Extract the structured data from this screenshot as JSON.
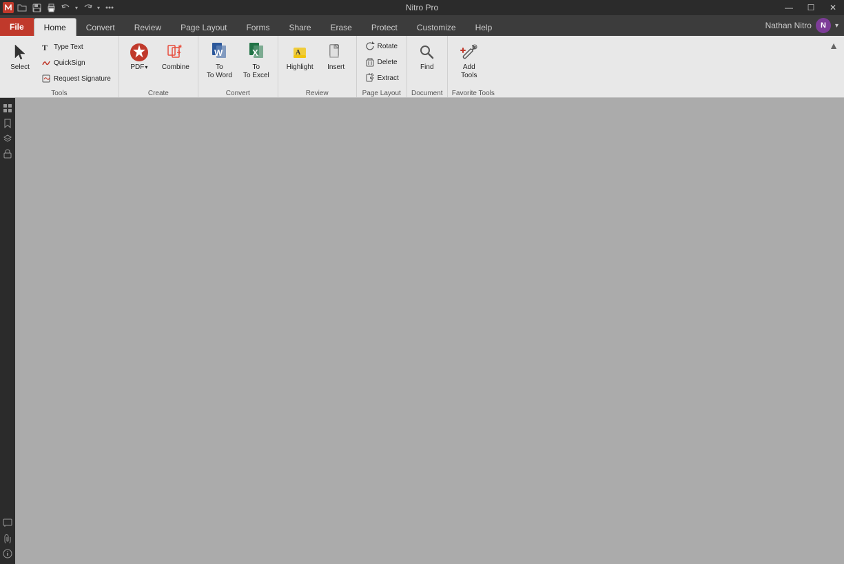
{
  "app": {
    "title": "Nitro Pro",
    "logo_letter": "N"
  },
  "window_controls": {
    "minimize": "—",
    "maximize": "☐",
    "close": "✕"
  },
  "quick_access": {
    "icons": [
      "save",
      "open",
      "print",
      "undo",
      "redo",
      "custom"
    ]
  },
  "tabs": [
    {
      "id": "file",
      "label": "File",
      "active": false
    },
    {
      "id": "home",
      "label": "Home",
      "active": true
    },
    {
      "id": "convert",
      "label": "Convert",
      "active": false
    },
    {
      "id": "review",
      "label": "Review",
      "active": false
    },
    {
      "id": "page-layout",
      "label": "Page Layout",
      "active": false
    },
    {
      "id": "forms",
      "label": "Forms",
      "active": false
    },
    {
      "id": "share",
      "label": "Share",
      "active": false
    },
    {
      "id": "erase",
      "label": "Erase",
      "active": false
    },
    {
      "id": "protect",
      "label": "Protect",
      "active": false
    },
    {
      "id": "customize",
      "label": "Customize",
      "active": false
    },
    {
      "id": "help",
      "label": "Help",
      "active": false
    }
  ],
  "user": {
    "name": "Nathan Nitro",
    "initials": "N"
  },
  "ribbon": {
    "groups": [
      {
        "id": "tools",
        "label": "Tools",
        "items": [
          {
            "id": "select",
            "label": "Select",
            "type": "large",
            "icon": "cursor"
          },
          {
            "id": "type-text",
            "label": "Type Text",
            "type": "small",
            "icon": "T"
          },
          {
            "id": "quicksign",
            "label": "QuickSign",
            "type": "small",
            "icon": "pen"
          },
          {
            "id": "request-signature",
            "label": "Request Signature",
            "type": "small",
            "icon": "doc-pen"
          }
        ]
      },
      {
        "id": "create",
        "label": "Create",
        "items": [
          {
            "id": "pdf",
            "label": "PDF",
            "type": "large-split",
            "icon": "pdf"
          },
          {
            "id": "combine",
            "label": "Combine",
            "type": "large",
            "icon": "combine"
          }
        ]
      },
      {
        "id": "convert",
        "label": "Convert",
        "items": [
          {
            "id": "to-word",
            "label": "To Word",
            "type": "large",
            "icon": "word"
          },
          {
            "id": "to-excel",
            "label": "To Excel",
            "type": "large",
            "icon": "excel"
          }
        ]
      },
      {
        "id": "review",
        "label": "Review",
        "items": [
          {
            "id": "highlight",
            "label": "Highlight",
            "type": "large",
            "icon": "highlight"
          },
          {
            "id": "insert",
            "label": "Insert",
            "type": "large",
            "icon": "insert"
          }
        ]
      },
      {
        "id": "page-layout",
        "label": "Page Layout",
        "items": [
          {
            "id": "rotate",
            "label": "Rotate",
            "type": "small",
            "icon": "rotate"
          },
          {
            "id": "delete",
            "label": "Delete",
            "type": "small",
            "icon": "delete"
          },
          {
            "id": "extract",
            "label": "Extract",
            "type": "small",
            "icon": "extract"
          }
        ]
      },
      {
        "id": "document",
        "label": "Document",
        "items": [
          {
            "id": "find",
            "label": "Find",
            "type": "large",
            "icon": "find"
          }
        ]
      },
      {
        "id": "favorite-tools",
        "label": "Favorite Tools",
        "items": [
          {
            "id": "add-tools",
            "label": "Add Tools",
            "type": "large",
            "icon": "add-tools"
          }
        ]
      }
    ]
  },
  "sidebar": {
    "top_icons": [
      "thumbnail",
      "bookmark",
      "layers",
      "lock"
    ],
    "bottom_icons": [
      "comment",
      "attachment",
      "info"
    ]
  }
}
